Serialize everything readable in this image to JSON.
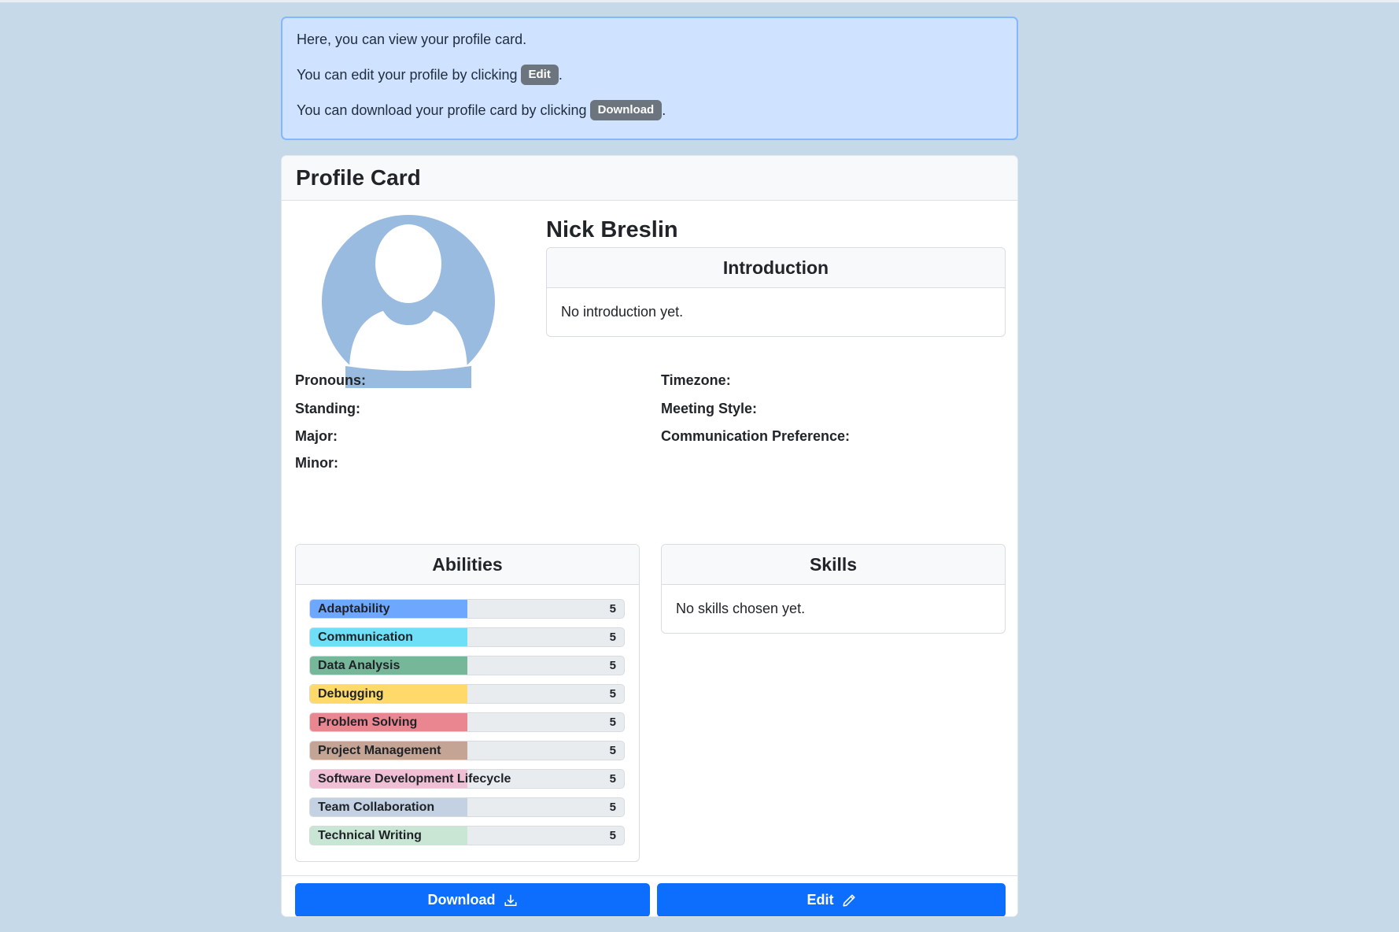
{
  "info": {
    "line1": "Here, you can view your profile card.",
    "line2_prefix": "You can edit your profile by clicking",
    "line2_chip": "Edit",
    "line2_suffix": ".",
    "line3_prefix": "You can download your profile card by clicking",
    "line3_chip": "Download",
    "line3_suffix": "."
  },
  "card": {
    "title": "Profile Card",
    "name": "Nick Breslin",
    "introduction": {
      "heading": "Introduction",
      "body": "No introduction yet."
    },
    "fields_left": [
      {
        "label": "Pronouns:"
      },
      {
        "label": "Standing:"
      },
      {
        "label": "Major:"
      },
      {
        "label": "Minor:"
      }
    ],
    "fields_right": [
      {
        "label": "Timezone:"
      },
      {
        "label": "Meeting Style:"
      },
      {
        "label": "Communication Preference:"
      }
    ],
    "abilities": {
      "heading": "Abilities",
      "items": [
        {
          "name": "Adaptability",
          "value": "5",
          "fraction": 0.5,
          "color": "#6ea8fe"
        },
        {
          "name": "Communication",
          "value": "5",
          "fraction": 0.5,
          "color": "#6edff6"
        },
        {
          "name": "Data Analysis",
          "value": "5",
          "fraction": 0.5,
          "color": "#75b798"
        },
        {
          "name": "Debugging",
          "value": "5",
          "fraction": 0.5,
          "color": "#ffda6a"
        },
        {
          "name": "Problem Solving",
          "value": "5",
          "fraction": 0.5,
          "color": "#ea868f"
        },
        {
          "name": "Project Management",
          "value": "5",
          "fraction": 0.5,
          "color": "#c4a595"
        },
        {
          "name": "Software Development Lifecycle",
          "value": "5",
          "fraction": 0.5,
          "color": "#efbfd4"
        },
        {
          "name": "Team Collaboration",
          "value": "5",
          "fraction": 0.5,
          "color": "#c3d1e3"
        },
        {
          "name": "Technical Writing",
          "value": "5",
          "fraction": 0.5,
          "color": "#c9e5d4"
        }
      ]
    },
    "skills": {
      "heading": "Skills",
      "body": "No skills chosen yet."
    }
  },
  "footer": {
    "download_label": "Download",
    "edit_label": "Edit"
  },
  "colors": {
    "background": "#c5d9e8",
    "alert_bg": "#cfe2ff",
    "alert_border": "#86b7fe",
    "primary": "#0d6efd",
    "chip": "#6c757d",
    "avatar": "#99bbe0"
  },
  "icons": {
    "download": "download-icon",
    "edit": "pencil-icon",
    "avatar": "person-placeholder-icon"
  }
}
